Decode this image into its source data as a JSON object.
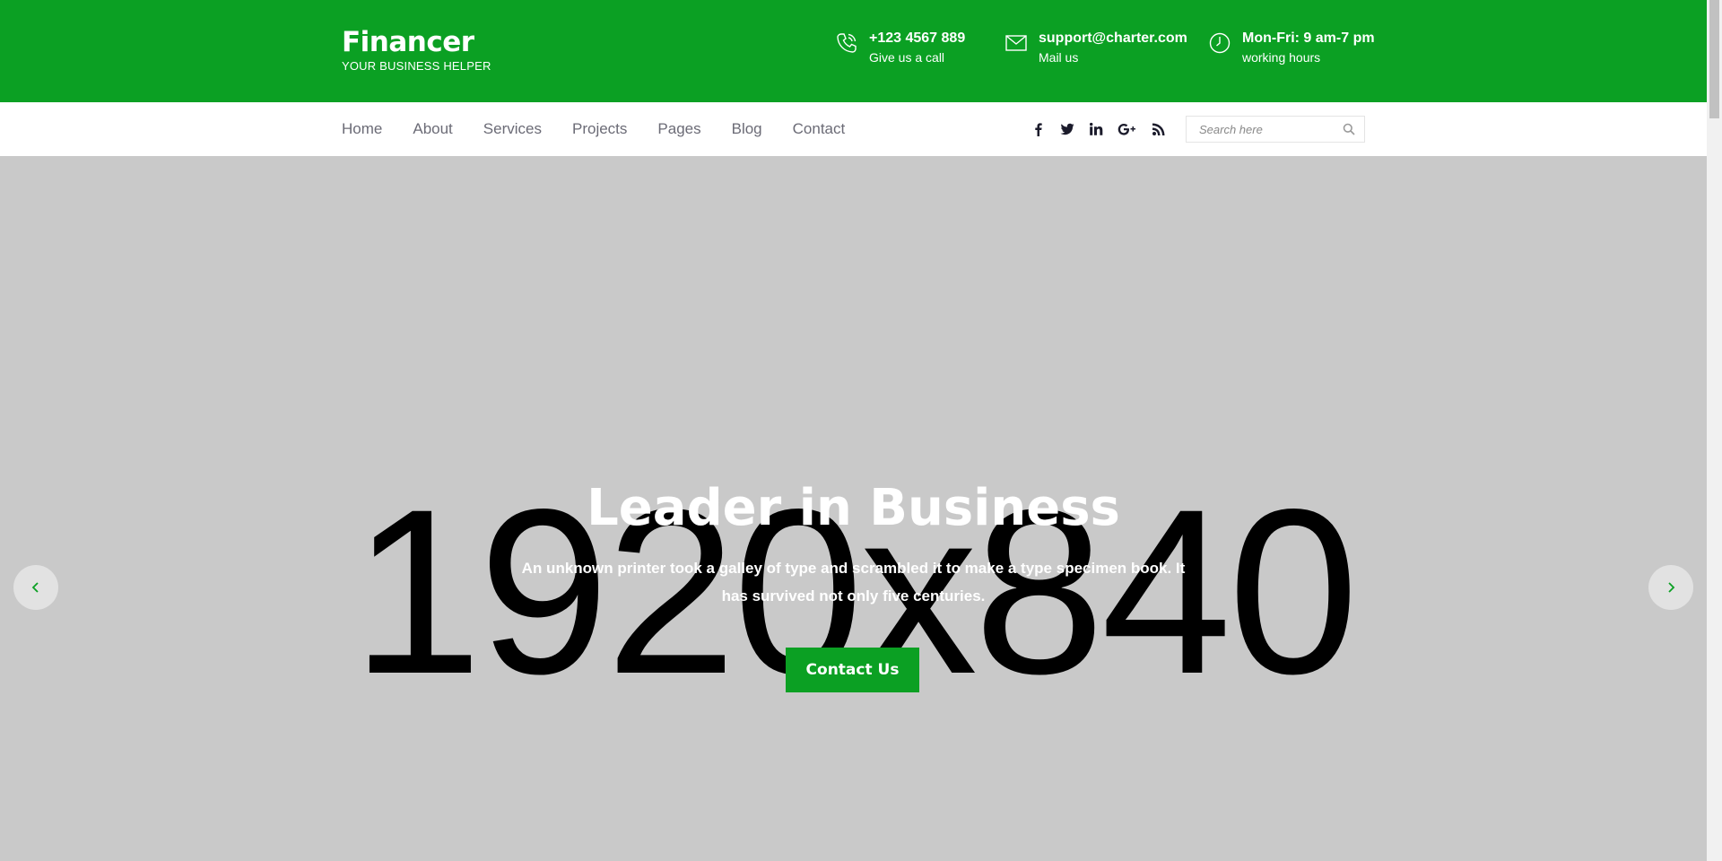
{
  "header": {
    "logo": {
      "name": "Financer",
      "tagline": "YOUR BUSINESS HELPER"
    },
    "contacts": [
      {
        "icon": "phone-icon",
        "main": "+123 4567 889",
        "sub": "Give us a call"
      },
      {
        "icon": "mail-icon",
        "main": "support@charter.com",
        "sub": "Mail us"
      },
      {
        "icon": "clock-icon",
        "main": "Mon-Fri: 9 am-7 pm",
        "sub": "working hours"
      }
    ],
    "accent_color": "#0ba023"
  },
  "nav": {
    "items": [
      "Home",
      "About",
      "Services",
      "Projects",
      "Pages",
      "Blog",
      "Contact"
    ],
    "social_icons": [
      "facebook-icon",
      "twitter-icon",
      "linkedin-icon",
      "google-plus-icon",
      "rss-icon"
    ],
    "search_placeholder": "Search here"
  },
  "hero": {
    "placeholder_text": "1920x840",
    "title": "Leader in Business",
    "text": "An unknown printer took a galley of type and scrambled it to make a type specimen book. It has survived not only five centuries.",
    "cta_label": "Contact Us"
  }
}
